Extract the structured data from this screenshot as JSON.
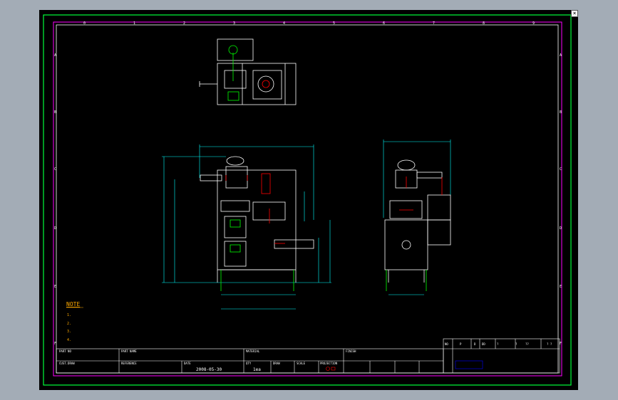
{
  "drawing": {
    "date": "2008-05-30",
    "qty": "1ea",
    "note_title": "NOTE",
    "notes": [
      "1.",
      "2.",
      "3.",
      "4."
    ],
    "column_labels": [
      "0",
      "1",
      "2",
      "3",
      "4",
      "5",
      "6",
      "7",
      "8",
      "9"
    ],
    "row_labels": [
      "A",
      "B",
      "C",
      "D",
      "E",
      "F"
    ],
    "titleblock": {
      "part_no": "PART NO",
      "part_name": "PART NAME",
      "material": "MATERIAL",
      "finish": "FINISH",
      "cust_draw": "CUST.DRAW",
      "reference": "REFERENCE",
      "date_label": "DATE",
      "qty_label": "QTY",
      "draw_label": "DRAW",
      "scale_label": "SCALE",
      "projection_label": "PROJECTION"
    },
    "revision_headers": [
      "NO",
      "P",
      "D",
      "DD",
      "?",
      "?",
      "??",
      "? ?"
    ]
  },
  "colors": {
    "border": "#00ff3a",
    "frame": "#ff00ff",
    "line": "#ffffff",
    "dim": "#00ffff",
    "note": "#ffaa00",
    "accent": "#ff0000",
    "detail": "#00ff00",
    "title_sel": "#0000ff"
  }
}
